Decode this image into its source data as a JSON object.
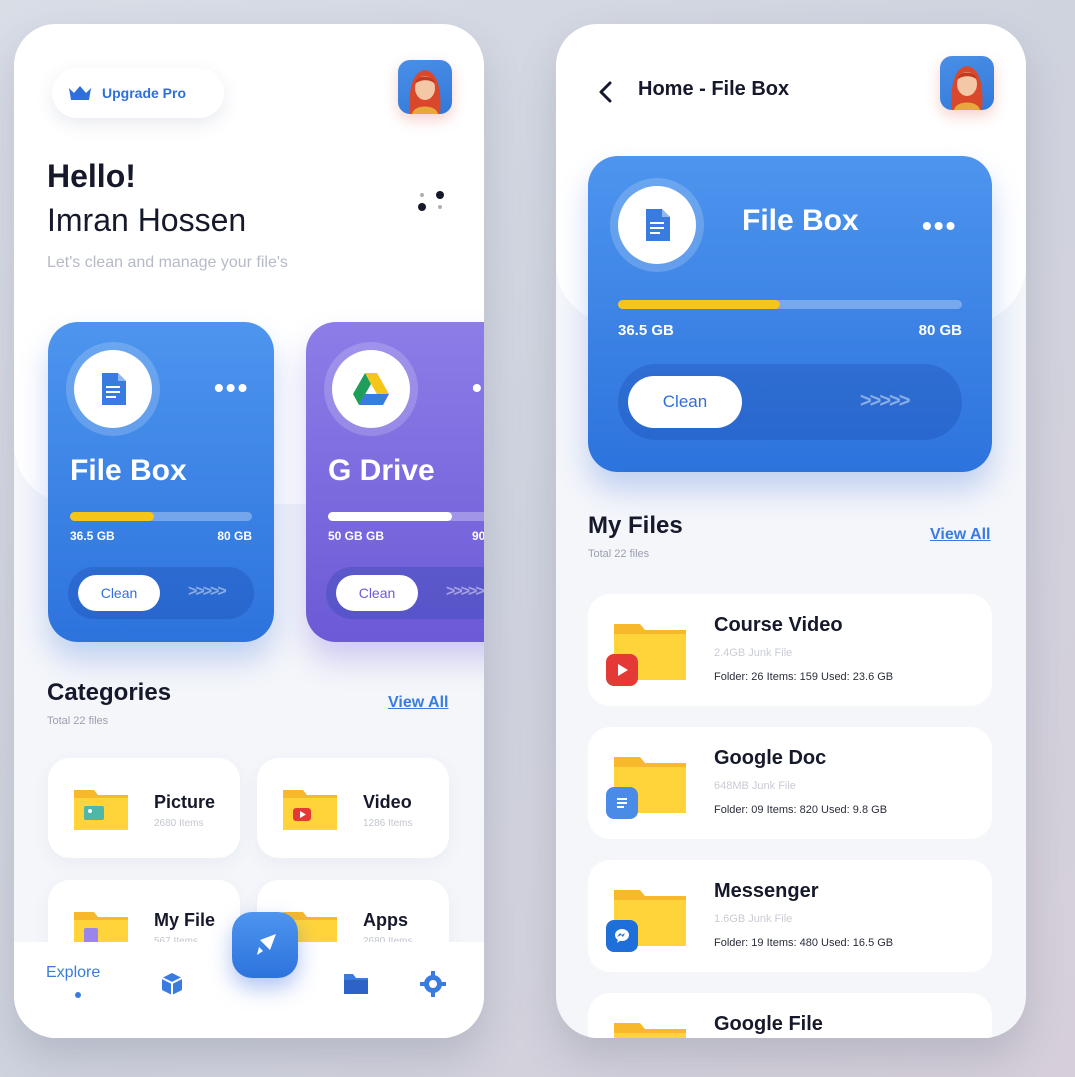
{
  "left": {
    "upgrade_label": "Upgrade Pro",
    "greeting": "Hello!",
    "user_name": "Imran Hossen",
    "subtitle": "Let's clean and manage your file's",
    "cards": [
      {
        "title": "File Box",
        "used": "36.5 GB",
        "total": "80 GB",
        "fill_fraction": 0.46,
        "clean_label": "Clean",
        "chevrons": ">>>>>",
        "more": "•••",
        "fill_color": "#f5c518"
      },
      {
        "title": "G Drive",
        "used": "50 GB GB",
        "total": "90",
        "fill_fraction": 0.68,
        "clean_label": "Clean",
        "chevrons": ">>>>>",
        "more": "•",
        "fill_color": "#ffffff"
      }
    ],
    "categories_title": "Categories",
    "categories_subtitle": "Total 22 files",
    "view_all": "View All",
    "categories": [
      {
        "name": "Picture",
        "count": "2680 Items"
      },
      {
        "name": "Video",
        "count": "1286 Items"
      },
      {
        "name": "My File",
        "count": "567 Items"
      },
      {
        "name": "Apps",
        "count": "2680 Items"
      }
    ],
    "nav": {
      "explore": "Explore"
    }
  },
  "right": {
    "header_title": "Home - File Box",
    "card": {
      "title": "File Box",
      "used": "36.5 GB",
      "total": "80 GB",
      "fill_fraction": 0.47,
      "clean_label": "Clean",
      "chevrons": ">>>>>",
      "more": "•••",
      "fill_color": "#f5c518"
    },
    "files_title": "My Files",
    "files_subtitle": "Total 22 files",
    "view_all": "View All",
    "files": [
      {
        "name": "Course Video",
        "junk": "2.4GB Junk File",
        "meta": "Folder: 26  Items: 159  Used: 23.6 GB"
      },
      {
        "name": "Google Doc",
        "junk": "648MB Junk File",
        "meta": "Folder: 09  Items: 820  Used: 9.8 GB"
      },
      {
        "name": "Messenger",
        "junk": "1.6GB Junk File",
        "meta": "Folder: 19  Items: 480  Used: 16.5 GB"
      },
      {
        "name": "Google File",
        "junk": "",
        "meta": ""
      }
    ]
  },
  "colors": {
    "accent": "#3a7be0",
    "card_blue": "#2d73dd",
    "card_purple": "#6c5ad6",
    "progress_yellow": "#f5c518"
  },
  "icons": {
    "upgrade": "crown-icon",
    "card_filebox": "document-icon",
    "card_gdrive": "google-drive-icon",
    "nav": [
      "box-icon",
      "rocket-icon",
      "folder-icon",
      "gear-icon"
    ],
    "back": "chevron-left-icon",
    "row_badges": [
      "youtube-icon",
      "document-icon",
      "messenger-icon"
    ]
  }
}
